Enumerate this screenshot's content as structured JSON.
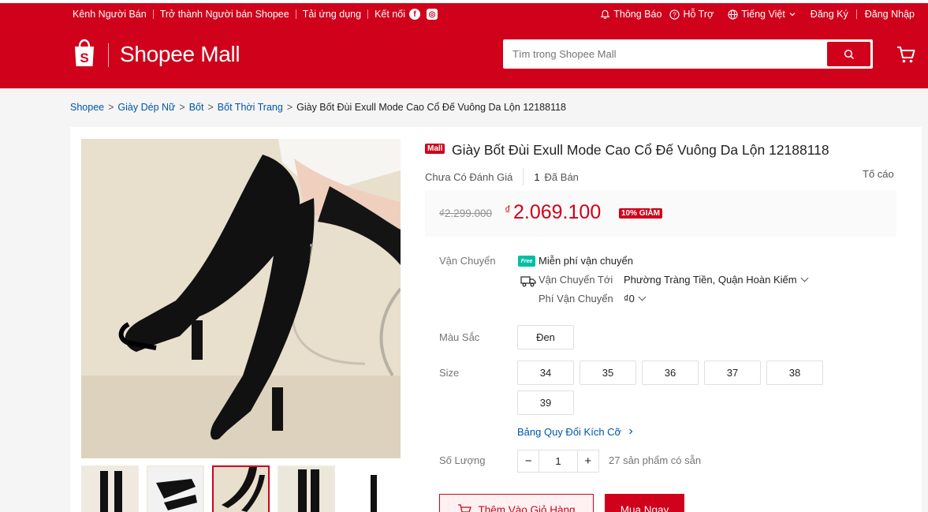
{
  "header": {
    "seller_channel": "Kênh Người Bán",
    "become_seller": "Trở thành Người bán Shopee",
    "download_app": "Tải ứng dụng",
    "connect": "Kết nối",
    "notifications": "Thông Báo",
    "support": "Hỗ Trợ",
    "language": "Tiếng Việt",
    "register": "Đăng Ký",
    "login": "Đăng Nhập",
    "logo_text": "Shopee Mall",
    "search_placeholder": "Tìm trong Shopee Mall",
    "brand_color": "#d0011b"
  },
  "breadcrumb": {
    "items": [
      "Shopee",
      "Giày Dép Nữ",
      "Bốt",
      "Bốt Thời Trang"
    ],
    "current": "Giày Bốt Đùi Exull Mode Cao Cổ Đế Vuông Da Lộn 12188118"
  },
  "product": {
    "mall_badge": "Mall",
    "title": "Giày Bốt Đùi Exull Mode Cao Cổ Đế Vuông Da Lộn 12188118",
    "rating_text": "Chưa Có Đánh Giá",
    "sold_count": "1",
    "sold_label": "Đã Bán",
    "report": "Tố cáo",
    "old_price": "₫2.299.000",
    "currency": "₫",
    "price": "2.069.100",
    "discount": "10% GIẢM",
    "shipping": {
      "label": "Vận Chuyển",
      "free_badge": "Free",
      "free_text": "Miễn phí vận chuyển",
      "to_label": "Vận Chuyển Tới",
      "to_value": "Phường Tràng Tiền, Quận Hoàn Kiếm",
      "fee_label": "Phí Vận Chuyển",
      "fee_value": "₫0"
    },
    "color": {
      "label": "Màu Sắc",
      "options": [
        "Đen"
      ]
    },
    "size": {
      "label": "Size",
      "options": [
        "34",
        "35",
        "36",
        "37",
        "38",
        "39"
      ],
      "guide": "Bảng Quy Đổi Kích Cỡ"
    },
    "quantity": {
      "label": "Số Lượng",
      "minus": "−",
      "value": "1",
      "plus": "+",
      "stock": "27 sản phẩm có sẵn"
    },
    "add_to_cart": "Thêm Vào Giỏ Hàng",
    "buy_now": "Mua Ngay"
  },
  "icons": [
    "bell-icon",
    "help-icon",
    "globe-icon",
    "facebook-icon",
    "instagram-icon",
    "shopee-bag-icon",
    "search-icon",
    "cart-icon",
    "free-shipping-icon",
    "truck-icon"
  ]
}
